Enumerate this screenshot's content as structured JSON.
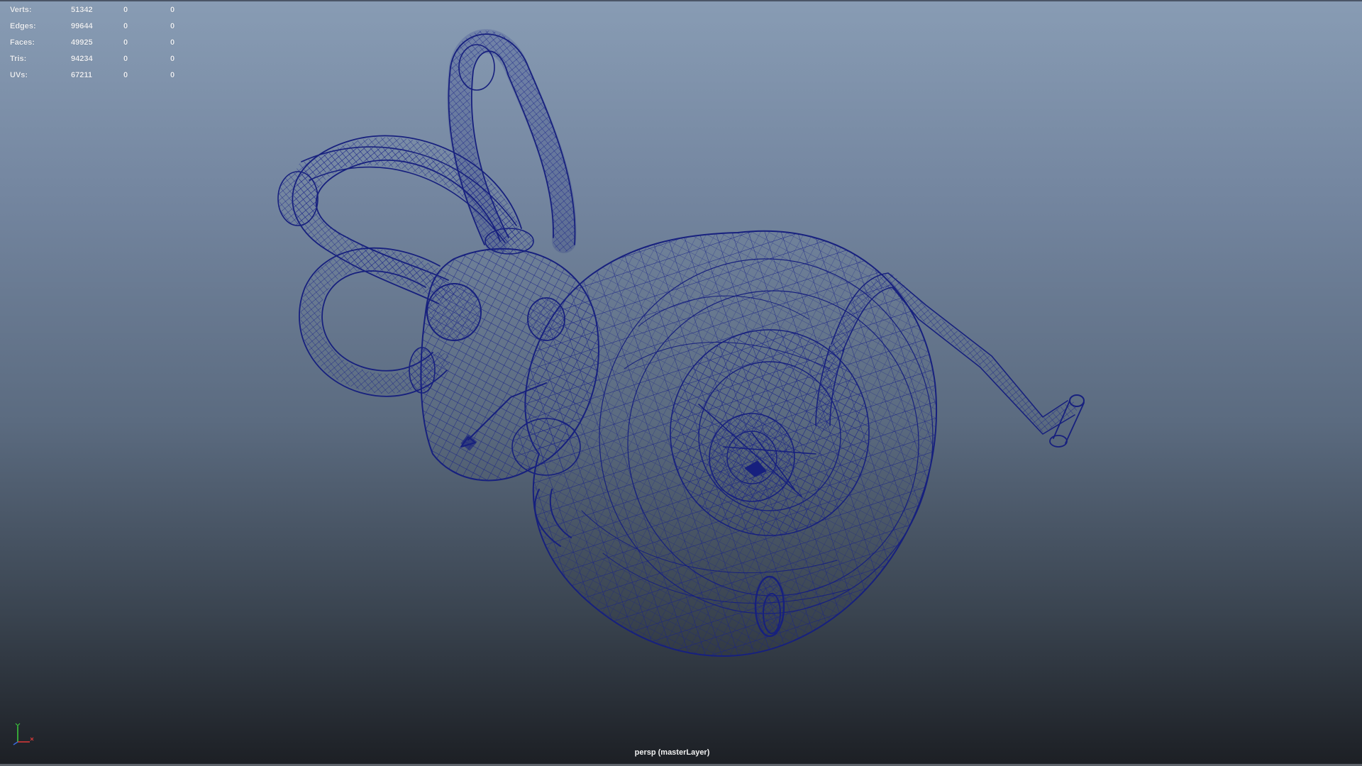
{
  "heads_up_display": {
    "rows": [
      {
        "label": "Verts:",
        "value": "51342",
        "selected": "0",
        "component": "0"
      },
      {
        "label": "Edges:",
        "value": "99644",
        "selected": "0",
        "component": "0"
      },
      {
        "label": "Faces:",
        "value": "49925",
        "selected": "0",
        "component": "0"
      },
      {
        "label": "Tris:",
        "value": "94234",
        "selected": "0",
        "component": "0"
      },
      {
        "label": "UVs:",
        "value": "67211",
        "selected": "0",
        "component": "0"
      }
    ]
  },
  "camera": {
    "label": "persp (masterLayer)"
  },
  "axis_indicator": {
    "icon": "xyz-axis-icon",
    "x_color": "#e03a3a",
    "y_color": "#3ccf3c",
    "z_color": "#3a6ae0"
  },
  "model": {
    "display_mode": "wireframe",
    "wire_color": "#17207e"
  },
  "viewport": {
    "background_top": "#889cb4",
    "background_bottom": "#1c1f24"
  }
}
